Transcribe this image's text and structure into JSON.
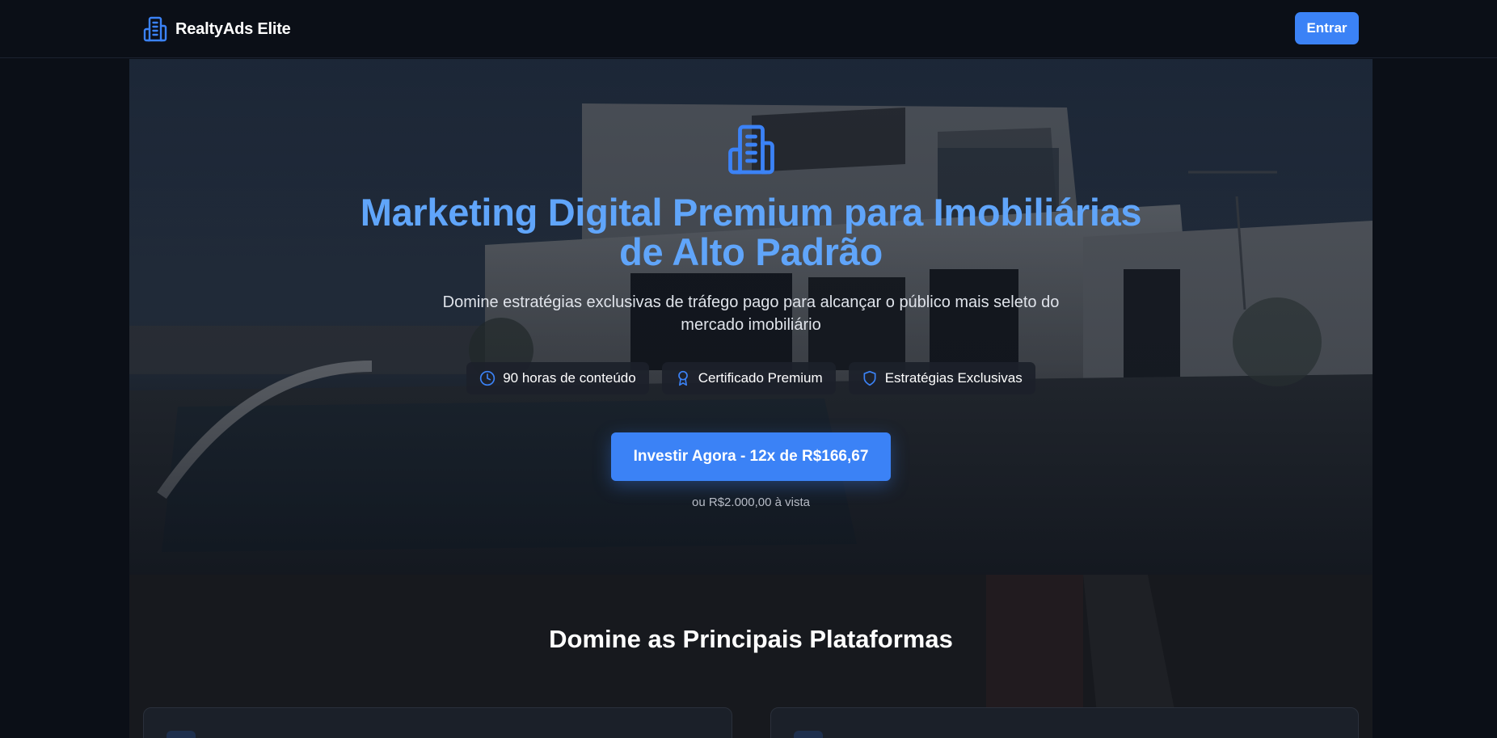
{
  "header": {
    "brand_name": "RealtyAds Elite",
    "brand_icon": "building-icon",
    "login_label": "Entrar"
  },
  "hero": {
    "icon": "building-icon",
    "title": "Marketing Digital Premium para Imobiliárias de Alto Padrão",
    "subtitle": "Domine estratégias exclusivas de tráfego pago para alcançar o público mais seleto do mercado imobiliário",
    "features": [
      {
        "icon": "clock-icon",
        "label": "90 horas de conteúdo"
      },
      {
        "icon": "award-icon",
        "label": "Certificado Premium"
      },
      {
        "icon": "shield-icon",
        "label": "Estratégias Exclusivas"
      }
    ],
    "cta_label": "Investir Agora - 12x de R$166,67",
    "price_note": "ou R$2.000,00 à vista"
  },
  "platforms": {
    "title": "Domine as Principais Plataformas"
  },
  "colors": {
    "accent": "#3b82f6",
    "title_gradient": "#60a5fa",
    "background": "#0b0f17"
  }
}
